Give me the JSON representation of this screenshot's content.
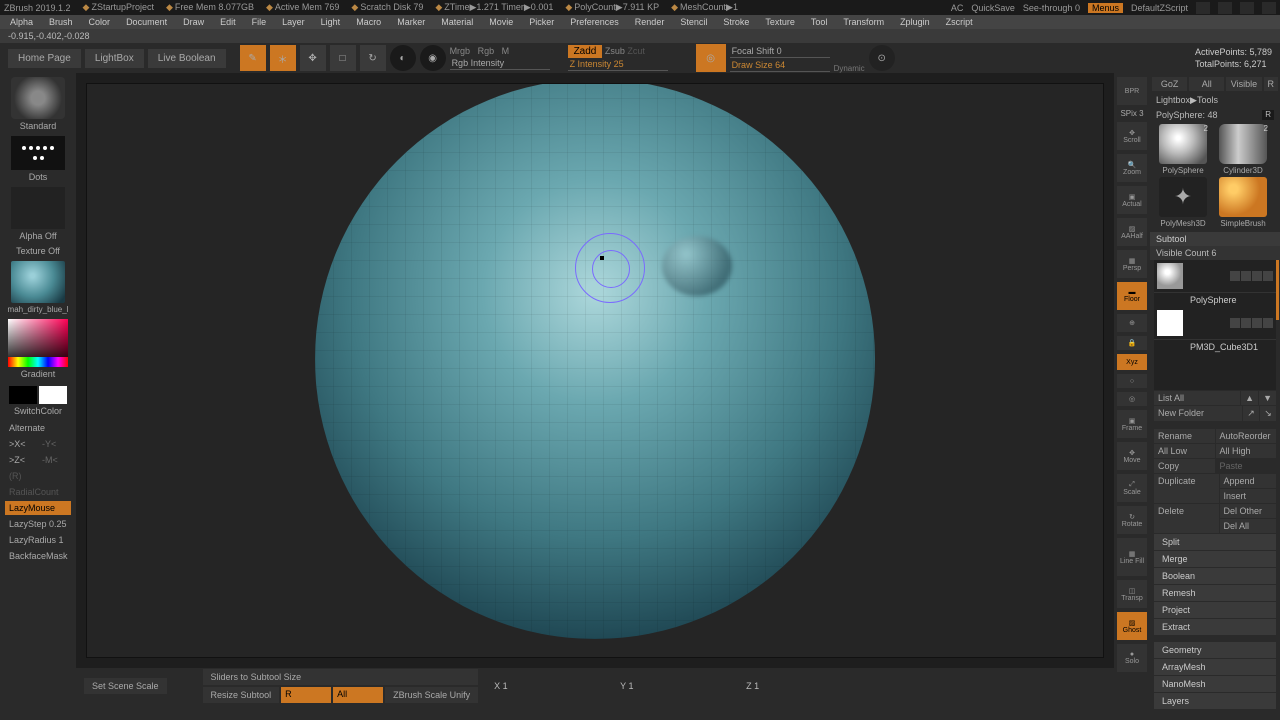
{
  "topbar": {
    "app": "ZBrush 2019.1.2",
    "project": "ZStartupProject",
    "mem": "Free Mem 8.077GB",
    "active": "Active Mem 769",
    "scratch": "Scratch Disk 79",
    "ztime": "ZTime▶1.271 Timer▶0.001",
    "poly": "PolyCount▶7.911 KP",
    "mesh": "MeshCount▶1",
    "ac": "AC",
    "quicksave": "QuickSave",
    "seethrough": "See-through  0",
    "menus": "Menus",
    "default": "DefaultZScript"
  },
  "menus": [
    "Alpha",
    "Brush",
    "Color",
    "Document",
    "Draw",
    "Edit",
    "File",
    "Layer",
    "Light",
    "Macro",
    "Marker",
    "Material",
    "Movie",
    "Picker",
    "Preferences",
    "Render",
    "Stencil",
    "Stroke",
    "Texture",
    "Tool",
    "Transform",
    "Zplugin",
    "Zscript"
  ],
  "coords": "-0.915,-0.402,-0.028",
  "toolbar": {
    "home": "Home Page",
    "lightbox": "LightBox",
    "live": "Live Boolean",
    "mrgb": "Mrgb",
    "rgb": "Rgb",
    "m": "M",
    "rgbint": "Rgb Intensity",
    "zadd": "Zadd",
    "zsub": "Zsub",
    "zcut": "Zcut",
    "zint": "Z Intensity 25",
    "focal": "Focal Shift 0",
    "draw": "Draw Size 64",
    "dynamic": "Dynamic",
    "active_pts": "ActivePoints: 5,789",
    "total_pts": "TotalPoints: 6,271"
  },
  "left": {
    "brush": "Standard",
    "stroke": "Dots",
    "alpha": "Alpha Off",
    "texture": "Texture Off",
    "material": "mah_dirty_blue_l",
    "gradient": "Gradient",
    "switch": "SwitchColor",
    "alternate": "Alternate",
    "xpos": ">X<",
    "yneg": "-Y<",
    "zpos": ">Z<",
    "mneg": "-M<",
    "r": "(R)",
    "radial": "RadialCount",
    "lazy": "LazyMouse",
    "lazystep": "LazyStep 0.25",
    "lazyrad": "LazyRadius 1",
    "backface": "BackfaceMask"
  },
  "bottom": {
    "scene": "Set Scene Scale",
    "sliders": "Sliders to Subtool Size",
    "resize": "Resize Subtool",
    "r": "R",
    "all": "All",
    "unify": "ZBrush Scale Unify",
    "x": "X 1",
    "y": "Y 1",
    "z": "Z 1"
  },
  "rstrip": {
    "bpr": "BPR",
    "spix": "SPix 3",
    "scroll": "Scroll",
    "zoom": "Zoom",
    "actual": "Actual",
    "aahalf": "AAHalf",
    "persp": "Persp",
    "floor": "Floor",
    "local": "Local",
    "xyz": "Xyz",
    "frame": "Frame",
    "move": "Move",
    "scale": "Scale",
    "rot": "Rotate",
    "linefill": "Line Fill",
    "transp": "Transp",
    "ghost": "Ghost",
    "solo": "Solo"
  },
  "right": {
    "tabs": {
      "goz": "GoZ",
      "all": "All",
      "visible": "Visible",
      "r": "R"
    },
    "lightbox": "Lightbox▶Tools",
    "polysphere": "PolySphere: 48",
    "tools": [
      {
        "name": "PolySphere",
        "thumb": "sphere-t",
        "badge": "2"
      },
      {
        "name": "Cylinder3D",
        "thumb": "cyl-t",
        "badge": "2"
      },
      {
        "name": "PolyMesh3D",
        "thumb": "star-t"
      },
      {
        "name": "SimpleBrush",
        "thumb": "brush-t"
      }
    ],
    "subtool": "Subtool",
    "visible_count": "Visible Count 6",
    "items": [
      {
        "name": "PolySphere",
        "cls": "sphere"
      },
      {
        "name": "PM3D_Cube3D1",
        "cls": "cube"
      }
    ],
    "list_all": "List All",
    "new_folder": "New Folder",
    "rename": "Rename",
    "autoreorder": "AutoReorder",
    "all_low": "All Low",
    "all_high": "All High",
    "copy": "Copy",
    "paste": "Paste",
    "duplicate": "Duplicate",
    "append": "Append",
    "insert": "Insert",
    "delete": "Delete",
    "delother": "Del Other",
    "delall": "Del All",
    "split": "Split",
    "merge": "Merge",
    "boolean": "Boolean",
    "remesh": "Remesh",
    "project": "Project",
    "extract": "Extract",
    "accordions": [
      "Geometry",
      "ArrayMesh",
      "NanoMesh",
      "Layers"
    ]
  }
}
